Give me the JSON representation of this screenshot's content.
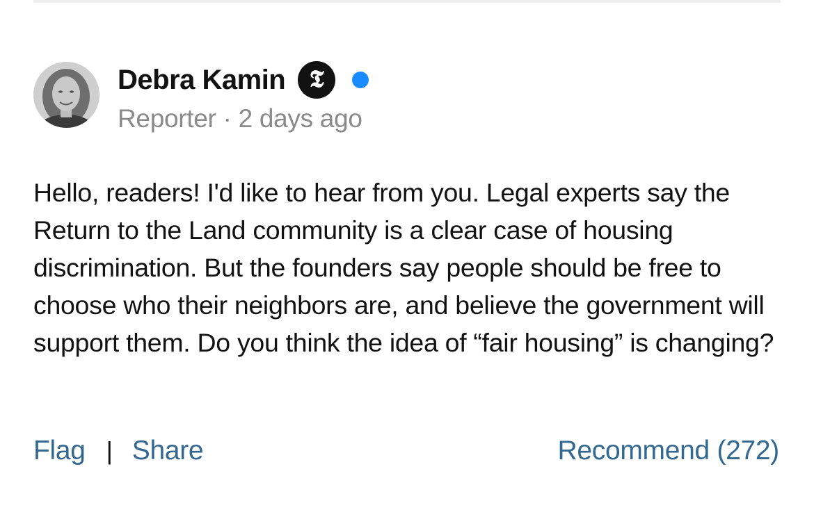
{
  "author": {
    "name": "Debra Kamin",
    "badge_glyph": "𝕿",
    "online_color": "#1a8cff"
  },
  "meta": {
    "role": "Reporter",
    "separator": "·",
    "timestamp": "2 days ago"
  },
  "comment": {
    "text": "Hello, readers! I'd like to hear from you. Legal experts say the Return to the Land community is a clear case of housing discrimination. But the founders say people should be free to choose who their neighbors are, and believe the government will support them. Do you think the idea of “fair housing” is changing?"
  },
  "actions": {
    "flag_label": "Flag",
    "divider": "|",
    "share_label": "Share",
    "recommend_label": "Recommend (272)"
  },
  "colors": {
    "link": "#326891",
    "meta": "#8a8a8a",
    "text": "#121212"
  }
}
